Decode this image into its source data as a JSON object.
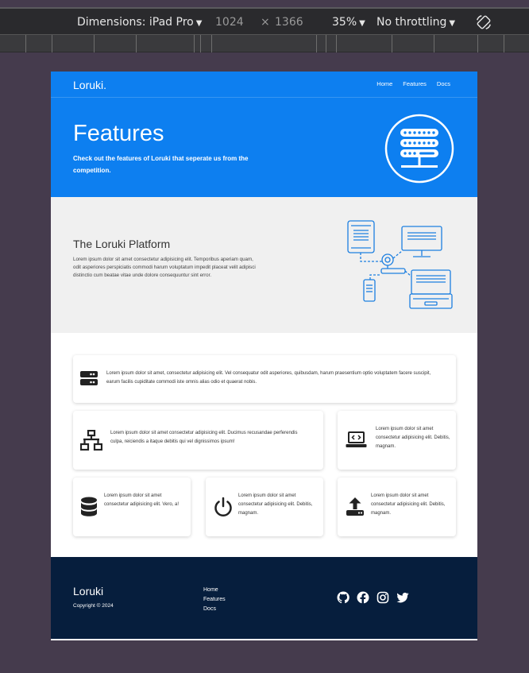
{
  "devtools": {
    "dimensions_label": "Dimensions: iPad Pro",
    "width": "1024",
    "times": "×",
    "height": "1366",
    "zoom": "35%",
    "throttling": "No throttling",
    "caret": "▼"
  },
  "site": {
    "brand": "Loruki.",
    "nav": [
      "Home",
      "Features",
      "Docs"
    ],
    "hero": {
      "title": "Features",
      "subtitle": "Check out the features of Loruki that seperate us from the competition."
    },
    "platform": {
      "title": "The Loruki Platform",
      "text": "Lorem ipsum dolor sit amet consectetur adipisicing elit. Temporibus aperiam quam, odit asperiores perspiciatis commodi harum voluptatum impedit placeat velit adipisci distinctio cum beatae vitae unde dolore consequuntur sint error."
    },
    "features": [
      {
        "icon": "server-icon",
        "text": "Lorem ipsum dolor sit amet, consectetur adipisicing elit. Vel consequatur odit asperiores, quibusdam, harum praesentium optio voluptatem facere suscipit, earum facilis cupiditate commodi iste omnis alias odio et quaerat nobis."
      },
      {
        "icon": "network-icon",
        "text": "Lorem ipsum dolor sit amet consectetur adipisicing elit. Ducimus recusandae perferendis culpa, reiciendis a itaque debitis qui vel dignissimos ipsum!"
      },
      {
        "icon": "laptop-code-icon",
        "text": "Lorem ipsum dolor sit amet consectetur adipisicing elit. Debitis, magnam."
      },
      {
        "icon": "database-icon",
        "text": "Lorem ipsum dolor sit amet consectetur adipisicing elit. Vero, a!"
      },
      {
        "icon": "power-icon",
        "text": "Lorem ipsum dolor sit amet consectetur adipisicing elit. Debitis, magnam."
      },
      {
        "icon": "upload-icon",
        "text": "Lorem ipsum dolor sit amet consectetur adipisicing elit. Debitis, magnam."
      }
    ],
    "footer": {
      "brand": "Loruki",
      "copyright": "Copyright © 2024",
      "links": [
        "Home",
        "Features",
        "Docs"
      ],
      "social": [
        "github-icon",
        "facebook-icon",
        "instagram-icon",
        "twitter-icon"
      ]
    },
    "colors": {
      "primary": "#0d7ff0",
      "light": "#f0f0f0",
      "dark": "#061e3d",
      "devtools_bg": "#2a2a2d",
      "viewport_bg": "#453b4d"
    }
  }
}
